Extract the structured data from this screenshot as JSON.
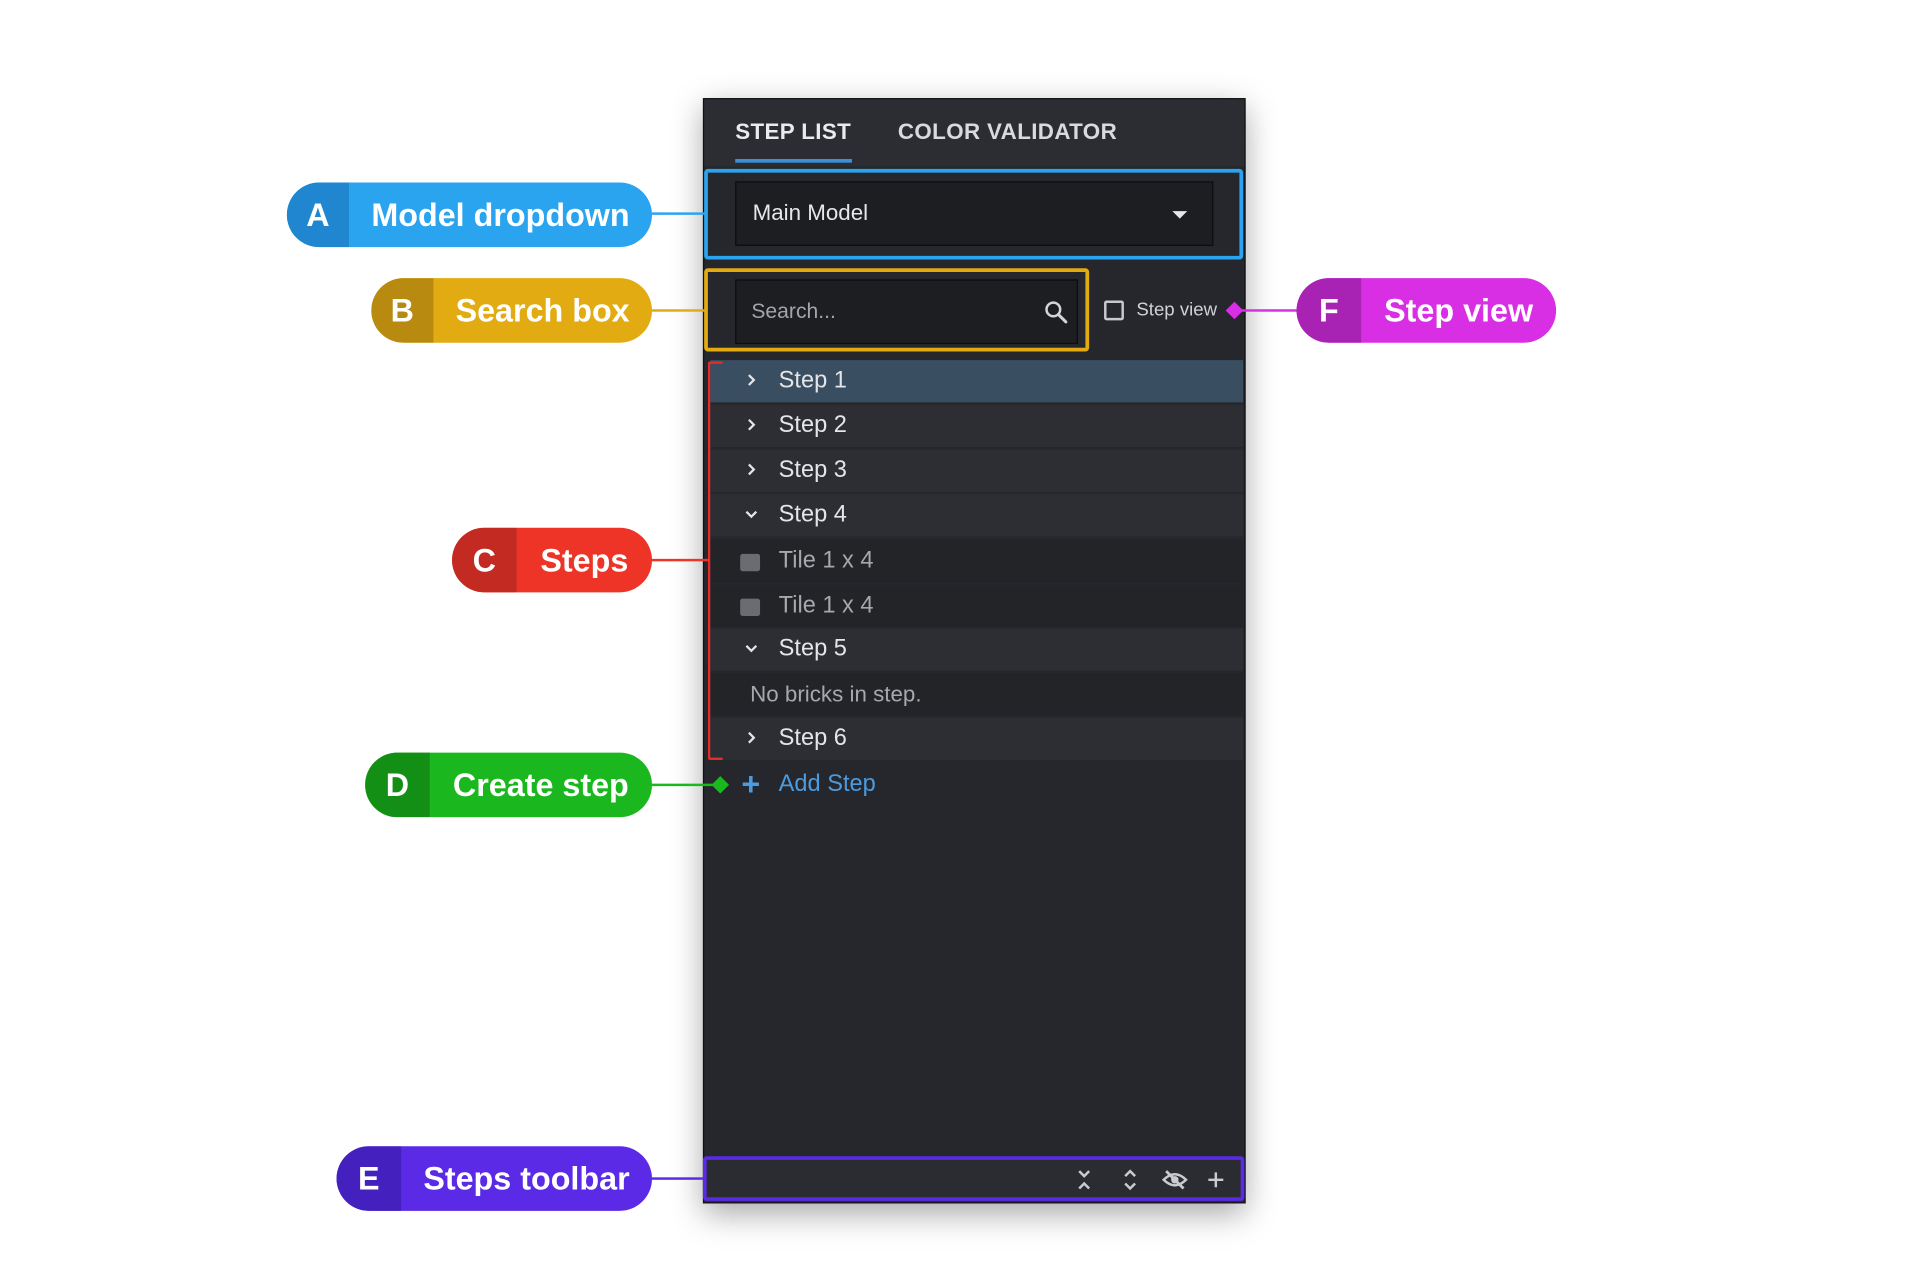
{
  "tabs": [
    {
      "label": "STEP LIST",
      "active": true
    },
    {
      "label": "COLOR VALIDATOR",
      "active": false
    }
  ],
  "model_dropdown": {
    "selected": "Main Model"
  },
  "search": {
    "placeholder": "Search..."
  },
  "step_view": {
    "label": "Step view",
    "checked": false
  },
  "steps": [
    {
      "label": "Step 1",
      "expanded": false,
      "selected": true
    },
    {
      "label": "Step 2",
      "expanded": false
    },
    {
      "label": "Step 3",
      "expanded": false
    },
    {
      "label": "Step 4",
      "expanded": true,
      "children": [
        "Tile 1 x 4",
        "Tile 1 x 4"
      ]
    },
    {
      "label": "Step 5",
      "expanded": true,
      "empty_text": "No bricks in step."
    },
    {
      "label": "Step 6",
      "expanded": false
    }
  ],
  "add_step": {
    "label": "Add Step"
  },
  "toolbar": {
    "icons": [
      "collapse-all-icon",
      "expand-all-icon",
      "hide-icon",
      "add-icon"
    ]
  },
  "annotations": [
    {
      "letter": "A",
      "text": "Model dropdown",
      "color": "#2aa4ef",
      "dark": "#1f86cf"
    },
    {
      "letter": "B",
      "text": "Search box",
      "color": "#e2ab12",
      "dark": "#b98a10"
    },
    {
      "letter": "C",
      "text": "Steps",
      "color": "#ee3327",
      "dark": "#c32a22"
    },
    {
      "letter": "D",
      "text": "Create step",
      "color": "#1bb71e",
      "dark": "#138f16"
    },
    {
      "letter": "E",
      "text": "Steps toolbar",
      "color": "#5a2ae6",
      "dark": "#4420bf"
    },
    {
      "letter": "F",
      "text": "Step view",
      "color": "#d82ee4",
      "dark": "#a823b4"
    }
  ],
  "colors": {
    "accent": "#3d8fd6",
    "link": "#4a9be0",
    "panel": "#25272c",
    "selected_row": "#3a4e61"
  }
}
